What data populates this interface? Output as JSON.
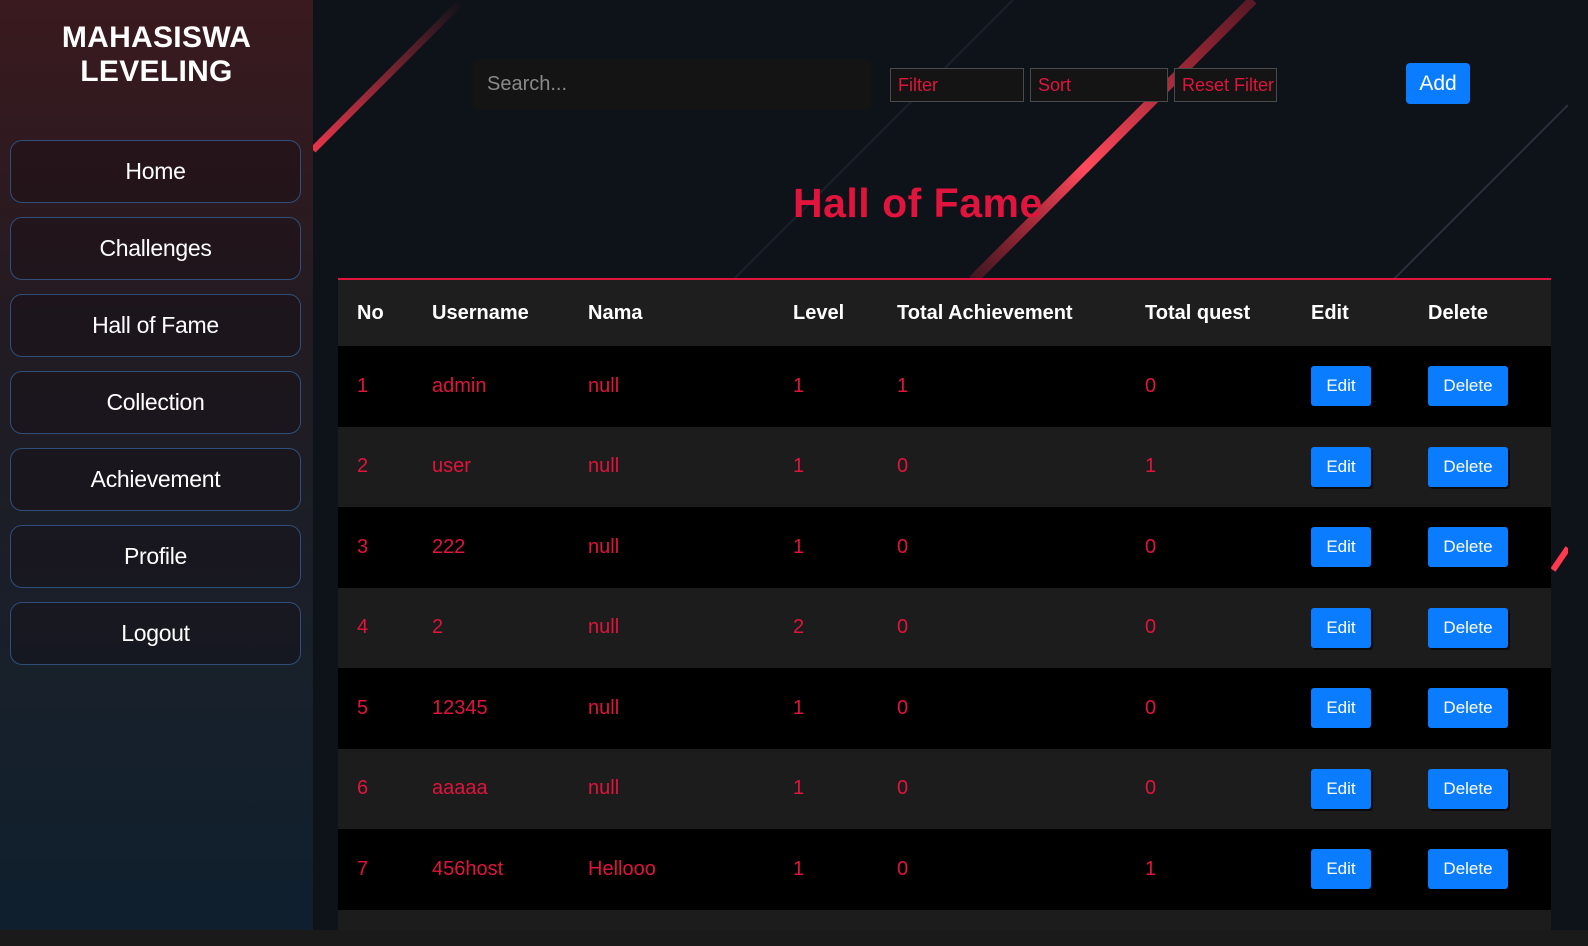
{
  "brand": {
    "line1": "MAHASISWA",
    "line2": "LEVELING"
  },
  "nav": [
    {
      "label": "Home"
    },
    {
      "label": "Challenges"
    },
    {
      "label": "Hall of Fame"
    },
    {
      "label": "Collection"
    },
    {
      "label": "Achievement"
    },
    {
      "label": "Profile"
    },
    {
      "label": "Logout"
    }
  ],
  "toolbar": {
    "search_placeholder": "Search...",
    "filter_label": "Filter",
    "sort_label": "Sort",
    "reset_label": "Reset Filter",
    "add_label": "Add"
  },
  "page_title": "Hall of Fame",
  "table": {
    "headers": [
      "No",
      "Username",
      "Nama",
      "Level",
      "Total Achievement",
      "Total quest",
      "Edit",
      "Delete"
    ],
    "edit_label": "Edit",
    "delete_label": "Delete",
    "rows": [
      {
        "no": "1",
        "username": "admin",
        "nama": "null",
        "level": "1",
        "achievement": "1",
        "quest": "0"
      },
      {
        "no": "2",
        "username": "user",
        "nama": "null",
        "level": "1",
        "achievement": "0",
        "quest": "1"
      },
      {
        "no": "3",
        "username": "222",
        "nama": "null",
        "level": "1",
        "achievement": "0",
        "quest": "0"
      },
      {
        "no": "4",
        "username": "2",
        "nama": "null",
        "level": "2",
        "achievement": "0",
        "quest": "0"
      },
      {
        "no": "5",
        "username": "12345",
        "nama": "null",
        "level": "1",
        "achievement": "0",
        "quest": "0"
      },
      {
        "no": "6",
        "username": "aaaaa",
        "nama": "null",
        "level": "1",
        "achievement": "0",
        "quest": "0"
      },
      {
        "no": "7",
        "username": "456host",
        "nama": "Hellooo",
        "level": "1",
        "achievement": "0",
        "quest": "1"
      }
    ]
  },
  "colors": {
    "accent": "#e0143c",
    "button": "#0a7cff"
  }
}
